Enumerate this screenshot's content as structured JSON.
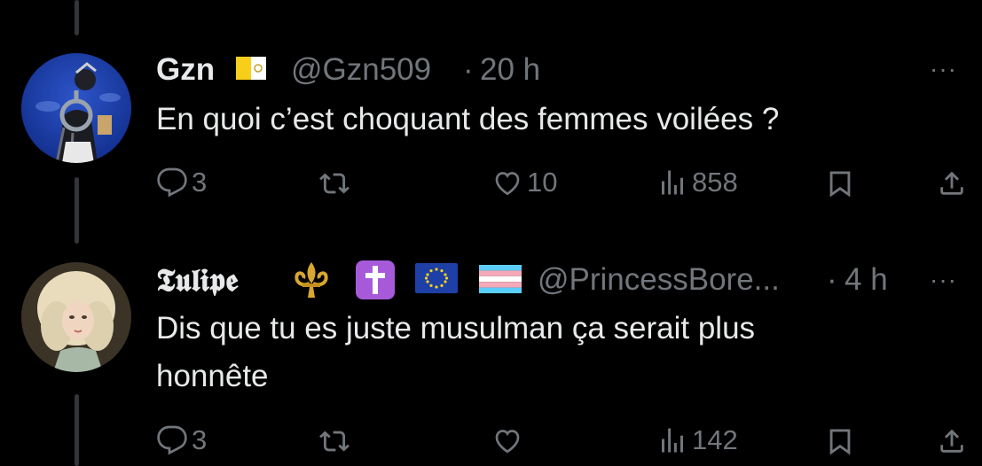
{
  "tweets": [
    {
      "display_name": "Gzn",
      "handle": "@Gzn509",
      "separator": "·",
      "time": "20 h",
      "more": "···",
      "text": "En quoi c’est choquant des femmes voilées ?",
      "badges": [
        "vatican-flag"
      ],
      "actions": {
        "replies": "3",
        "reposts": "",
        "likes": "10",
        "views": "858"
      }
    },
    {
      "display_name": "𝕿𝖚𝖑𝖎𝖕𝖊",
      "handle": "@PrincessBore...",
      "separator": "·",
      "time": "4 h",
      "more": "···",
      "text_line1": "Dis que tu es juste musulman ça serait plus",
      "text_line2": "honnête",
      "badges": [
        "fleur-de-lis",
        "latin-cross",
        "eu-flag",
        "transgender-flag"
      ],
      "actions": {
        "replies": "3",
        "reposts": "",
        "likes": "",
        "views": "142"
      }
    }
  ],
  "colors": {
    "background": "#000000",
    "text": "#e7e9ea",
    "secondary": "#71767b",
    "thread_line": "#333639"
  }
}
